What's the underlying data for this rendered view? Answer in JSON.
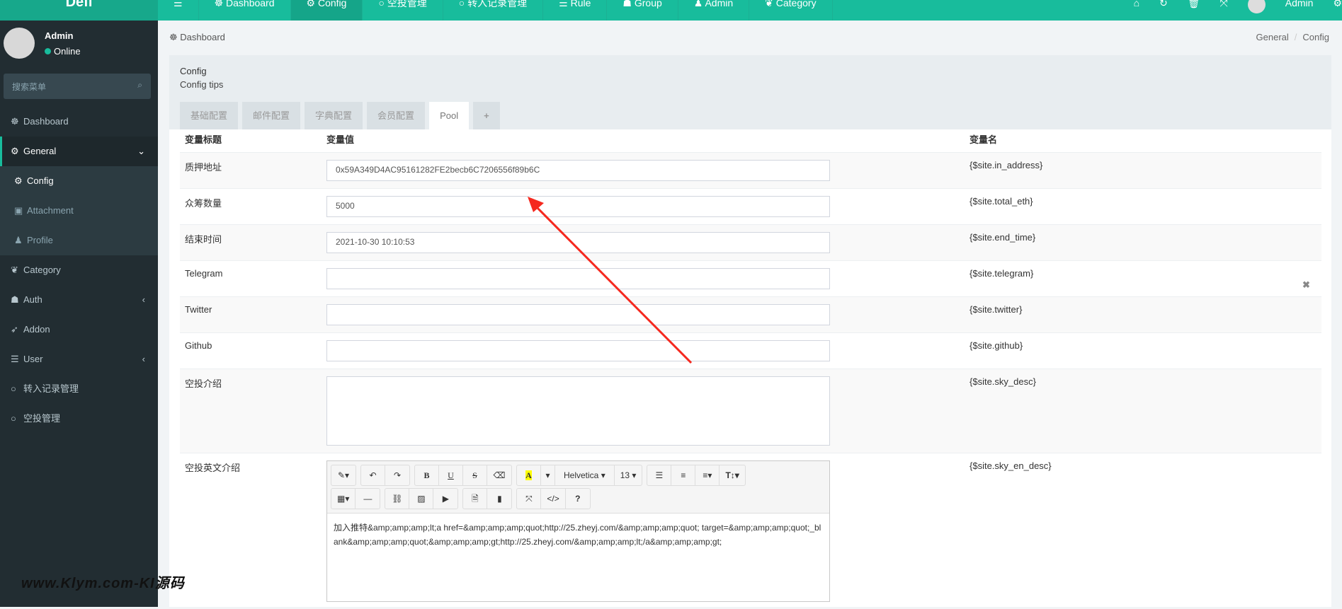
{
  "header": {
    "logo": "Defi",
    "nav": [
      "Dashboard",
      "Config",
      "空投管理",
      "转入记录管理",
      "Rule",
      "Group",
      "Admin",
      "Category"
    ],
    "user": "Admin"
  },
  "sidebar": {
    "user": "Admin",
    "status": "Online",
    "search_placeholder": "搜索菜单",
    "items": [
      {
        "label": "Dashboard",
        "icon": "☸"
      },
      {
        "label": "General",
        "icon": "⚙"
      },
      {
        "label": "Config",
        "icon": "⚙"
      },
      {
        "label": "Attachment",
        "icon": "▣"
      },
      {
        "label": "Profile",
        "icon": "♟"
      },
      {
        "label": "Category",
        "icon": "❦"
      },
      {
        "label": "Auth",
        "icon": "☗"
      },
      {
        "label": "Addon",
        "icon": "➶"
      },
      {
        "label": "User",
        "icon": "☰"
      },
      {
        "label": "转入记录管理",
        "icon": "○"
      },
      {
        "label": "空投管理",
        "icon": "○"
      }
    ]
  },
  "breadcrumb": {
    "left": "Dashboard",
    "path": [
      "General",
      "Config"
    ]
  },
  "panel": {
    "title": "Config",
    "tips": "Config tips",
    "tabs": [
      "基础配置",
      "邮件配置",
      "字典配置",
      "会员配置",
      "Pool",
      "+"
    ]
  },
  "table": {
    "headers": [
      "变量标题",
      "变量值",
      "变量名"
    ],
    "rows": [
      {
        "title": "质押地址",
        "value": "0x59A349D4AC95161282FE2becb6C7206556f89b6C",
        "name": "{$site.in_address}"
      },
      {
        "title": "众筹数量",
        "value": "5000",
        "name": "{$site.total_eth}"
      },
      {
        "title": "结束时间",
        "value": "2021-10-30 10:10:53",
        "name": "{$site.end_time}"
      },
      {
        "title": "Telegram",
        "value": "",
        "name": "{$site.telegram}"
      },
      {
        "title": "Twitter",
        "value": "",
        "name": "{$site.twitter}"
      },
      {
        "title": "Github",
        "value": "",
        "name": "{$site.github}"
      },
      {
        "title": "空投介绍",
        "value": "",
        "name": "{$site.sky_desc}"
      },
      {
        "title": "空投英文介绍",
        "value": "加入推特&amp;amp;amp;lt;a href=&amp;amp;amp;quot;http://25.zheyj.com/&amp;amp;amp;quot; target=&amp;amp;amp;quot;_blank&amp;amp;amp;quot;&amp;amp;amp;gt;http://25.zheyj.com/&amp;amp;amp;lt;/a&amp;amp;amp;gt;",
        "name": "{$site.sky_en_desc}"
      }
    ]
  },
  "editor": {
    "font": "Helvetica ▾",
    "size": "13 ▾"
  },
  "watermark": "www.Klym.com-KI源码",
  "colors": {
    "brand": "#18bc9c",
    "sidebar": "#222d32",
    "arrow": "#f5291f"
  }
}
